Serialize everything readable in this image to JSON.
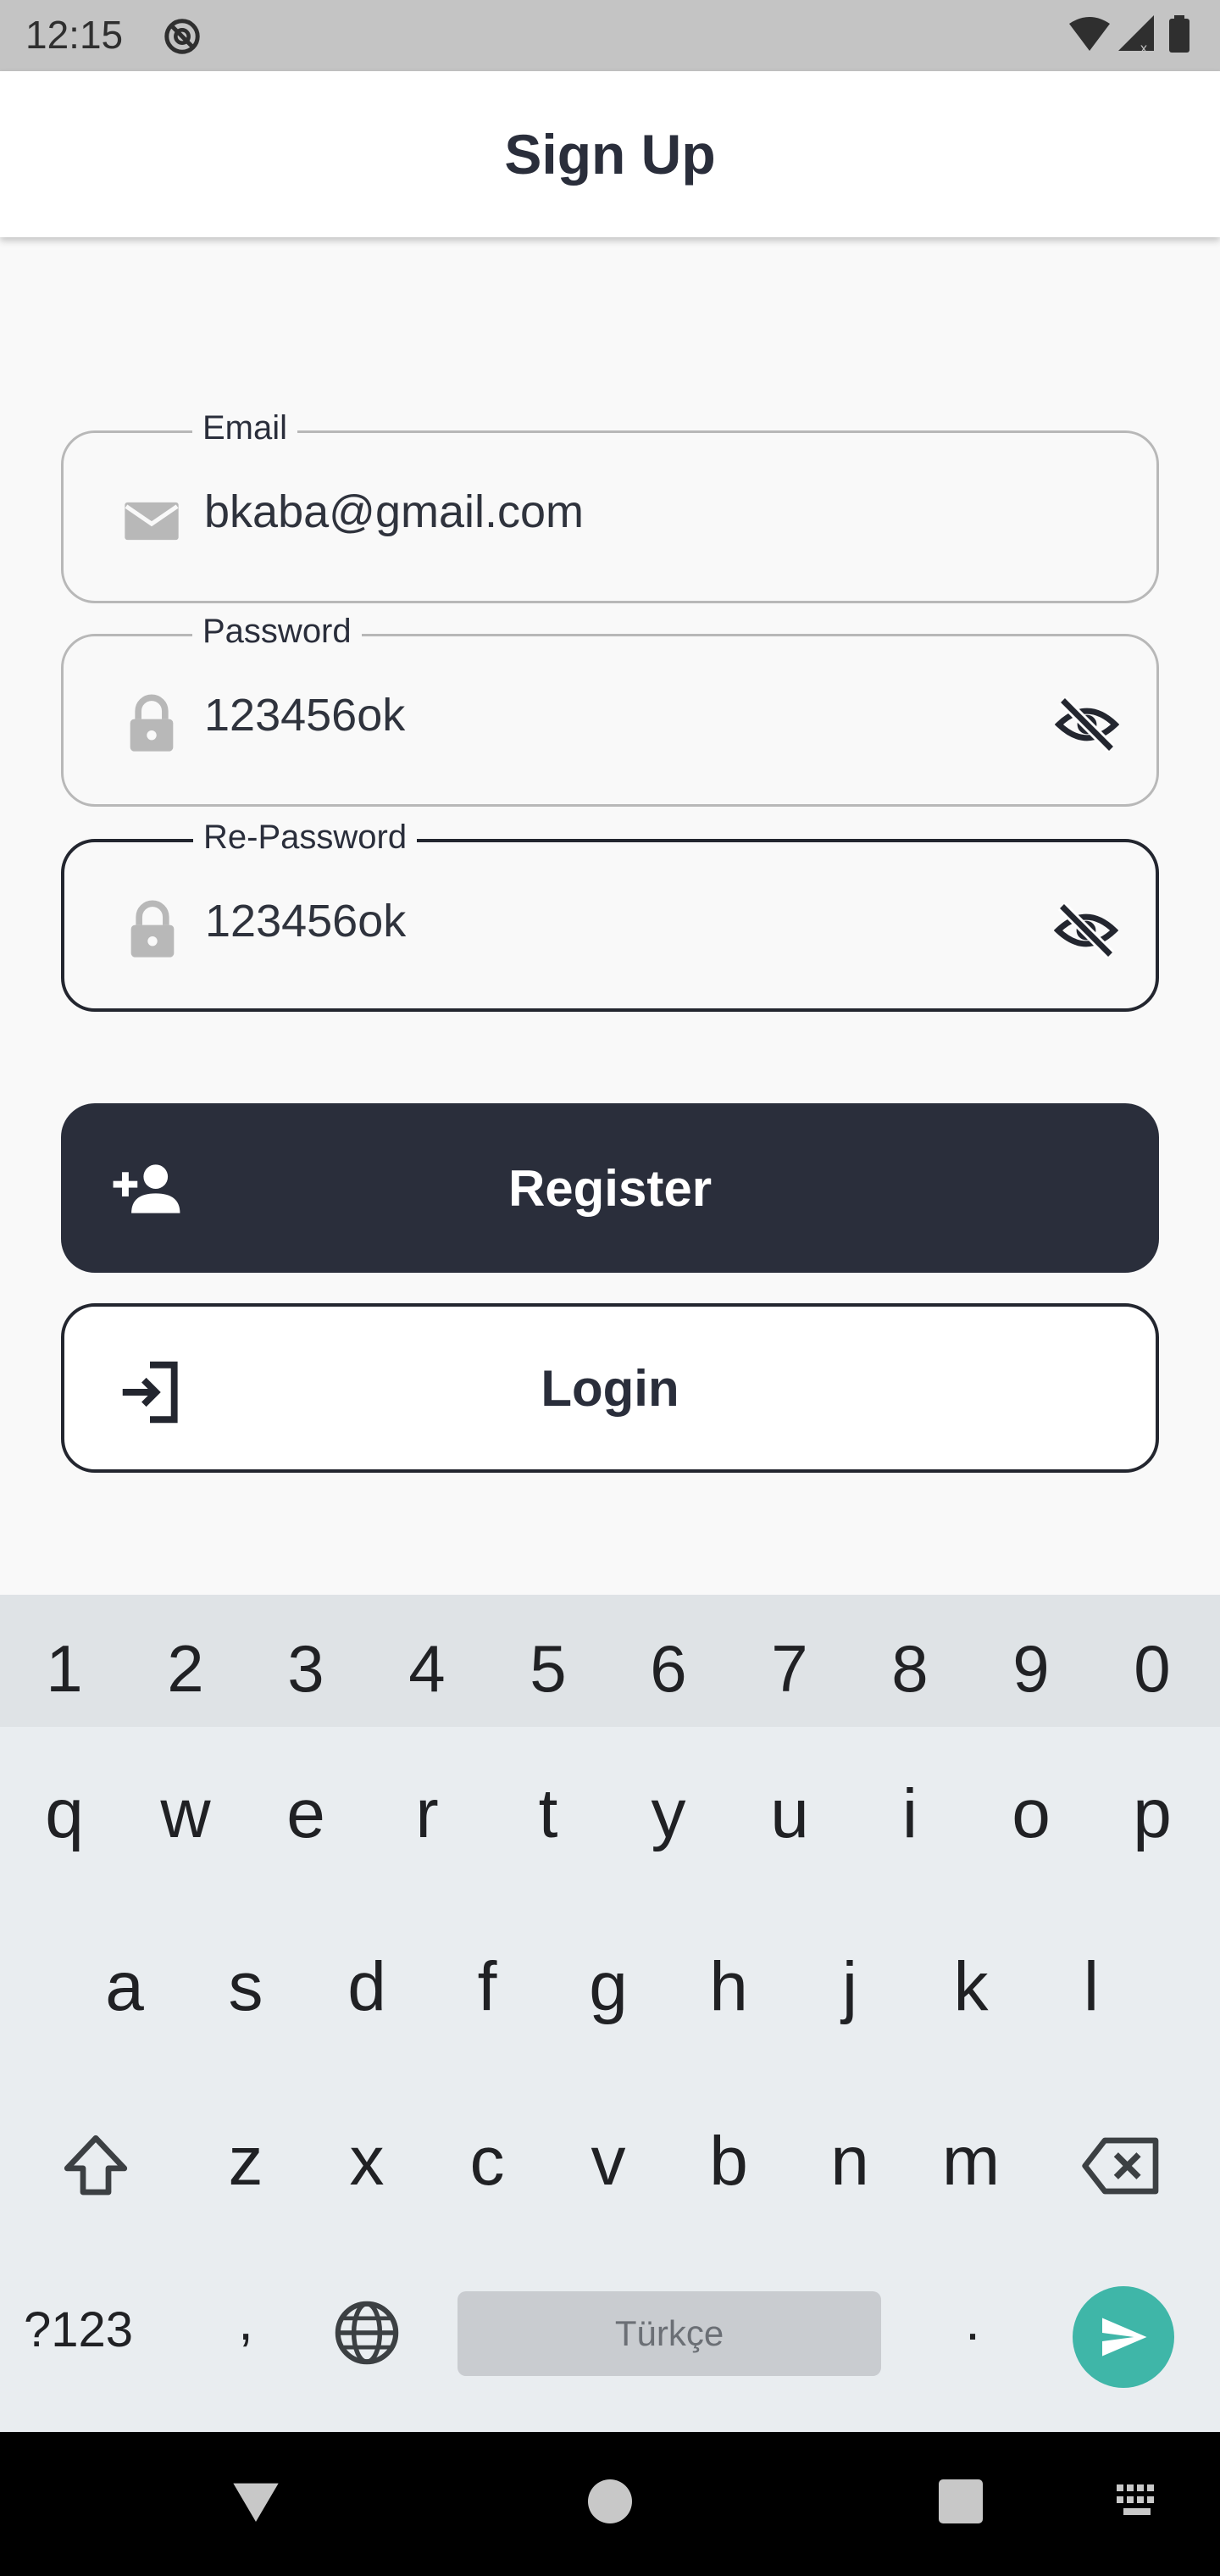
{
  "status_bar": {
    "time": "12:15",
    "icons": [
      "do-not-disturb-icon",
      "wifi-icon",
      "signal-icon",
      "battery-icon"
    ]
  },
  "app_bar": {
    "title": "Sign Up"
  },
  "form": {
    "email": {
      "label": "Email",
      "value": "bkaba@gmail.com",
      "icon": "mail-icon"
    },
    "password": {
      "label": "Password",
      "value": "123456ok",
      "icon": "lock-icon",
      "suffix_icon": "visibility-off-icon"
    },
    "repassword": {
      "label": "Re-Password",
      "value": "123456ok",
      "icon": "lock-icon",
      "suffix_icon": "visibility-off-icon",
      "focused": true
    }
  },
  "buttons": {
    "register": {
      "label": "Register",
      "icon": "person-add-icon"
    },
    "login": {
      "label": "Login",
      "icon": "login-icon"
    }
  },
  "keyboard": {
    "numbers": [
      "1",
      "2",
      "3",
      "4",
      "5",
      "6",
      "7",
      "8",
      "9",
      "0"
    ],
    "row1": [
      "q",
      "w",
      "e",
      "r",
      "t",
      "y",
      "u",
      "i",
      "o",
      "p"
    ],
    "row2": [
      "a",
      "s",
      "d",
      "f",
      "g",
      "h",
      "j",
      "k",
      "l"
    ],
    "row3": [
      "z",
      "x",
      "c",
      "v",
      "b",
      "n",
      "m"
    ],
    "symbols_label": "?123",
    "comma": ",",
    "space_label": "Türkçe",
    "period": ".",
    "accent_color": "#3fb6a8"
  },
  "colors": {
    "primary": "#2a2e3b",
    "background": "#f9f9f9",
    "status_bar": "#c4c4c4"
  }
}
